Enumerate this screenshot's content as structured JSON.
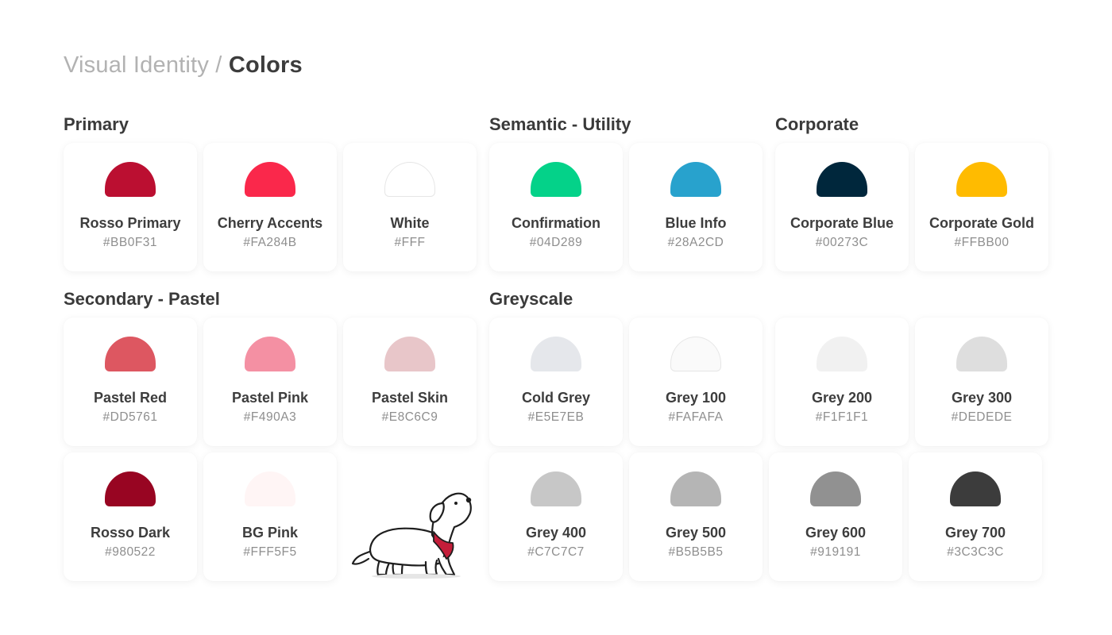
{
  "breadcrumb": {
    "parent": "Visual Identity",
    "separator": "/",
    "current": "Colors"
  },
  "sections": {
    "primary": "Primary",
    "semantic": "Semantic - Utility",
    "corporate": "Corporate",
    "secondary": "Secondary - Pastel",
    "greyscale": "Greyscale"
  },
  "colors": {
    "rosso_primary": {
      "name": "Rosso Primary",
      "hex": "#BB0F31"
    },
    "cherry_accents": {
      "name": "Cherry Accents",
      "hex": "#FA284B"
    },
    "white": {
      "name": "White",
      "hex": "#FFF"
    },
    "confirmation": {
      "name": "Confirmation",
      "hex": "#04D289"
    },
    "blue_info": {
      "name": "Blue Info",
      "hex": "#28A2CD"
    },
    "corporate_blue": {
      "name": "Corporate Blue",
      "hex": "#00273C"
    },
    "corporate_gold": {
      "name": "Corporate Gold",
      "hex": "#FFBB00"
    },
    "pastel_red": {
      "name": "Pastel Red",
      "hex": "#DD5761"
    },
    "pastel_pink": {
      "name": "Pastel Pink",
      "hex": "#F490A3"
    },
    "pastel_skin": {
      "name": "Pastel Skin",
      "hex": "#E8C6C9"
    },
    "cold_grey": {
      "name": "Cold Grey",
      "hex": "#E5E7EB"
    },
    "grey_100": {
      "name": "Grey 100",
      "hex": "#FAFAFA"
    },
    "grey_200": {
      "name": "Grey 200",
      "hex": "#F1F1F1"
    },
    "grey_300": {
      "name": "Grey 300",
      "hex": "#DEDEDE"
    },
    "rosso_dark": {
      "name": "Rosso Dark",
      "hex": "#980522"
    },
    "bg_pink": {
      "name": "BG Pink",
      "hex": "#FFF5F5"
    },
    "grey_400": {
      "name": "Grey 400",
      "hex": "#C7C7C7"
    },
    "grey_500": {
      "name": "Grey 500",
      "hex": "#B5B5B5"
    },
    "grey_600": {
      "name": "Grey 600",
      "hex": "#919191"
    },
    "grey_700": {
      "name": "Grey 700",
      "hex": "#3C3C3C"
    }
  },
  "mascot_icon": "dog-mascot-icon"
}
